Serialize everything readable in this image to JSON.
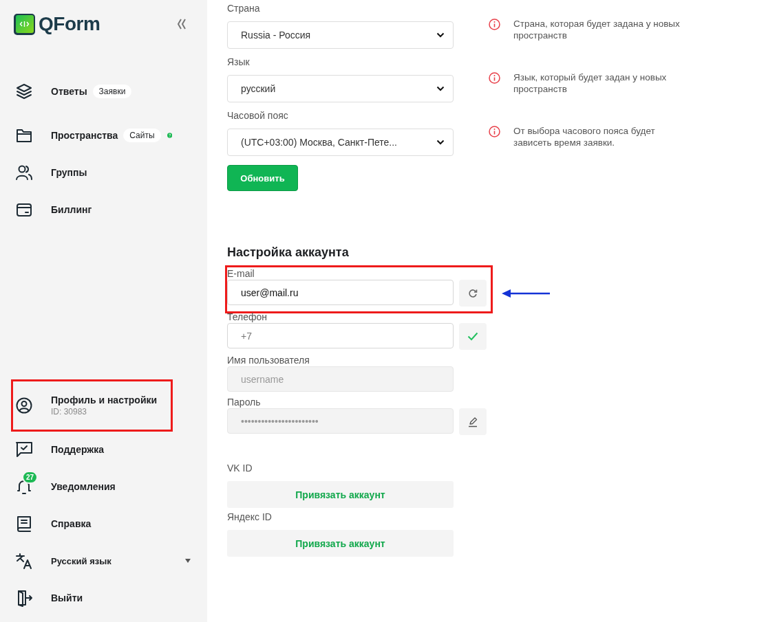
{
  "sidebar": {
    "logo_text": "QForm",
    "top_items": [
      {
        "label": "Ответы",
        "badge": "Заявки",
        "help": false,
        "highlighted": false
      },
      {
        "label": "Пространства",
        "badge": "Сайты",
        "help": true,
        "highlighted": false
      },
      {
        "label": "Группы",
        "help": false,
        "highlighted": false
      },
      {
        "label": "Биллинг",
        "help": false,
        "highlighted": false
      }
    ],
    "bottom_items": [
      {
        "label": "Профиль и настройки",
        "sublabel": "ID: 30983",
        "dropdown": false,
        "highlighted": true
      },
      {
        "label": "Поддержка",
        "dropdown": false,
        "highlighted": false
      },
      {
        "label": "Уведомления",
        "notification_count": "27",
        "dropdown": false,
        "highlighted": false
      },
      {
        "label": "Справка",
        "dropdown": false,
        "highlighted": false
      },
      {
        "label": "Русский язык",
        "dropdown": true,
        "highlighted": false
      },
      {
        "label": "Выйти",
        "dropdown": false,
        "highlighted": false
      }
    ]
  },
  "settings": [
    {
      "label": "Страна",
      "value": "Russia - Россия",
      "hint": "Страна, которая будет задана у новых пространств"
    },
    {
      "label": "Язык",
      "value": "русский",
      "hint": "Язык, который будет задан у новых пространств"
    },
    {
      "label": "Часовой пояс",
      "value": "(UTC+03:00) Москва, Санкт-Пете...",
      "hint": "От выбора часового пояса будет зависеть время заявки."
    }
  ],
  "update_button": "Обновить",
  "account": {
    "title": "Настройка аккаунта",
    "fields": [
      {
        "label": "E-mail",
        "value": "user@mail.ru",
        "disabled": false,
        "kind": "refresh",
        "highlighted": true,
        "pointer_arrow": true
      },
      {
        "label": "Телефон",
        "placeholder": "+7",
        "disabled": false,
        "kind": "confirm",
        "highlighted": false,
        "pointer_arrow": false
      },
      {
        "label": "Имя пользователя",
        "placeholder": "username",
        "disabled": true,
        "kind": "plain",
        "highlighted": false,
        "pointer_arrow": false
      },
      {
        "label": "Пароль",
        "placeholder": "•••••••••••••••••••••••",
        "disabled": true,
        "kind": "edit",
        "highlighted": false,
        "pointer_arrow": false
      }
    ]
  },
  "linked_accounts": [
    {
      "label": "VK ID",
      "button": "Привязать аккаунт"
    },
    {
      "label": "Яндекс ID",
      "button": "Привязать аккаунт"
    }
  ]
}
